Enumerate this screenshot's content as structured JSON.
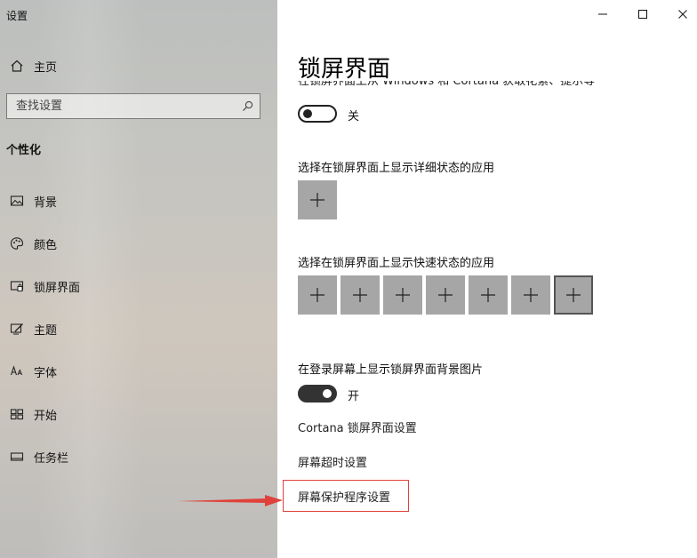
{
  "window": {
    "title": "设置"
  },
  "sidebar": {
    "home_label": "主页",
    "search_placeholder": "查找设置",
    "section_label": "个性化",
    "items": [
      {
        "label": "背景",
        "icon": "picture-icon"
      },
      {
        "label": "颜色",
        "icon": "palette-icon"
      },
      {
        "label": "锁屏界面",
        "icon": "lock-screen-icon"
      },
      {
        "label": "主题",
        "icon": "theme-icon"
      },
      {
        "label": "字体",
        "icon": "font-icon"
      },
      {
        "label": "开始",
        "icon": "start-icon"
      },
      {
        "label": "任务栏",
        "icon": "taskbar-icon"
      }
    ]
  },
  "titlebar": {
    "minimize": "minimize-icon",
    "maximize": "maximize-icon",
    "close": "close-icon"
  },
  "main": {
    "title": "锁屏界面",
    "cut_off_text": "在锁屏界面上从 Windows 和 Cortana 获取花絮、提示等",
    "fun_facts_toggle": {
      "state": "关",
      "on": false
    },
    "detailed_status_label": "选择在锁屏界面上显示详细状态的应用",
    "quick_status_label": "选择在锁屏界面上显示快速状态的应用",
    "quick_status_slots": 7,
    "signin_background_label": "在登录屏幕上显示锁屏界面背景图片",
    "signin_background_toggle": {
      "state": "开",
      "on": true
    },
    "links": {
      "cortana": "Cortana 锁屏界面设置",
      "screen_timeout": "屏幕超时设置",
      "screen_saver": "屏幕保护程序设置"
    }
  },
  "colors": {
    "accent_annotation": "#e0423b"
  }
}
